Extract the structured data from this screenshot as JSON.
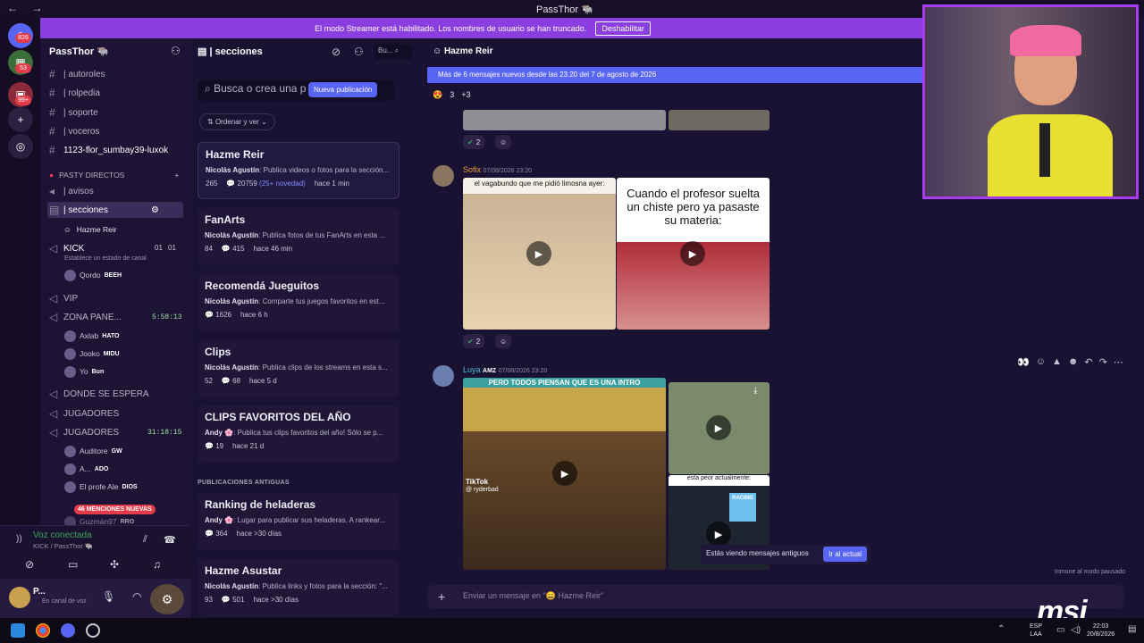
{
  "window": {
    "title": "PassThor 🐃",
    "nav": "← →"
  },
  "banner": {
    "text": "El modo Streamer está habilitado. Los nombres de usuario se han truncado.",
    "button": "Deshabilitar"
  },
  "rail": {
    "badges": [
      "826",
      "53",
      "99+"
    ]
  },
  "server": {
    "name": "PassThor 🐃"
  },
  "channels": [
    {
      "icon": "#",
      "label": "| autoroles"
    },
    {
      "icon": "#",
      "label": "| rolpedia"
    },
    {
      "icon": "#",
      "label": "| soporte"
    },
    {
      "icon": "#",
      "label": "| voceros"
    },
    {
      "icon": "#",
      "label": "1123-flor_sumbay39-luxok"
    }
  ],
  "category": {
    "label": "PASTY DIRECTOS"
  },
  "channels2": [
    {
      "label": "| avisos"
    },
    {
      "label": "| secciones"
    },
    {
      "label": "Hazme Reir"
    }
  ],
  "voice_channels": [
    {
      "label": "KICK",
      "counts": [
        "01",
        "01"
      ],
      "status": "Establece un estado de canal"
    },
    {
      "label": "VIP"
    },
    {
      "label": "ZONA PANE...",
      "timer": "5:58:13"
    },
    {
      "label": "DONDE SE ESPERA"
    },
    {
      "label": "JUGADORES"
    },
    {
      "label": "JUGADORES",
      "timer": "31:18:15"
    }
  ],
  "voice_users": [
    {
      "name": "Qordo",
      "tag": "BEEH"
    },
    {
      "name": "Axlab",
      "tag": "HATO"
    },
    {
      "name": "Jooko",
      "tag": "MIDU"
    },
    {
      "name": "Yo",
      "tag": "Bun"
    },
    {
      "name": "Auditore",
      "tag": "GW"
    },
    {
      "name": "A...",
      "tag": "ADO"
    },
    {
      "name": "El profe Ale",
      "tag": "DIOS"
    },
    {
      "name": "Guzmán97",
      "tag": "RRO"
    }
  ],
  "mentions": "46 MENCIONES NUEVAS",
  "voice": {
    "status": "Voz conectada",
    "location": "KICK / PassThor 🐃"
  },
  "userbar": {
    "name": "P...",
    "status": "En canal de voz"
  },
  "forum": {
    "title": "| secciones",
    "search_short": "Bu...",
    "search": "Busca o crea una p",
    "new_post": "Nueva publicación",
    "sort": "Ordenar y ver",
    "posts": [
      {
        "title": "Hazme Reir",
        "author": "Nicolás Agustín",
        "snippet": "Publica videos o fotos para la sección...",
        "a": "265",
        "b": "20759",
        "extra": "(25+ novedad)",
        "time": "hace 1 min"
      },
      {
        "title": "FanArts",
        "author": "Nicolás Agustín",
        "snippet": "Publica fotos de tus FanArts en esta ...",
        "a": "84",
        "b": "415",
        "time": "hace 46 min"
      },
      {
        "title": "Recomendá Jueguitos",
        "author": "Nicolás Agustín",
        "snippet": "Comparte tus juegos favoritos en est...",
        "a": "",
        "b": "1626",
        "time": "hace 6 h"
      },
      {
        "title": "Clips",
        "author": "Nicolás Agustín",
        "snippet": "Publica clips de los streams en esta s...",
        "a": "52",
        "b": "68",
        "time": "hace 5 d"
      },
      {
        "title": "CLIPS FAVORITOS DEL AÑO",
        "author": "Andy 🌸",
        "snippet": "Publica tus clips favoritos del año! Sólo se p...",
        "a": "",
        "b": "19",
        "time": "hace 21 d"
      }
    ],
    "old_header": "PUBLICACIONES ANTIGUAS",
    "old_posts": [
      {
        "title": "Ranking de heladeras",
        "author": "Andy 🌸",
        "snippet": "Lugar para publicar sus heladeras. A rankear...",
        "a": "",
        "b": "364",
        "time": "hace >30 días"
      },
      {
        "title": "Hazme Asustar",
        "author": "Nicolás Agustín",
        "snippet": "Publica links y fotos para la sección: \"...",
        "a": "93",
        "b": "501",
        "time": "hace >30 días"
      }
    ]
  },
  "chat": {
    "title": "Hazme Reir",
    "new_messages": "Más de 6 mensajes nuevos desde las 23:20 del 7 de agosto de 2026",
    "reactions_top": [
      "3",
      "+3"
    ],
    "r1": "2",
    "msg1": {
      "name": "Sofix",
      "time": "07/08/2026 23:20",
      "caption_left": "el vagabundo que me pidió limosna ayer:",
      "caption_right": "Cuando el profesor suelta un chiste pero ya pasaste su materia:"
    },
    "r2": "2",
    "msg2": {
      "name": "Luya",
      "tag": "AMZ",
      "time": "07/08/2026 23:20",
      "caption_left": "PERO TODOS PIENSAN QUE ES UNA INTRO",
      "tiktok": "TikTok",
      "tiktok_user": "@ ryderbad",
      "caption_right": "esta peor actualmente:",
      "team": "RACING"
    },
    "toast": "Estás viendo mensajes antiguos",
    "toast_button": "Ir al actual",
    "immune": "Inmune al modo pausado",
    "compose": "Enviar un mensaje en \"😄 Hazme Reir\""
  },
  "taskbar": {
    "lang": "ESP",
    "region": "LAA",
    "clock_time": "22:03",
    "clock_date": "20/8/2026"
  },
  "brand": "msi"
}
